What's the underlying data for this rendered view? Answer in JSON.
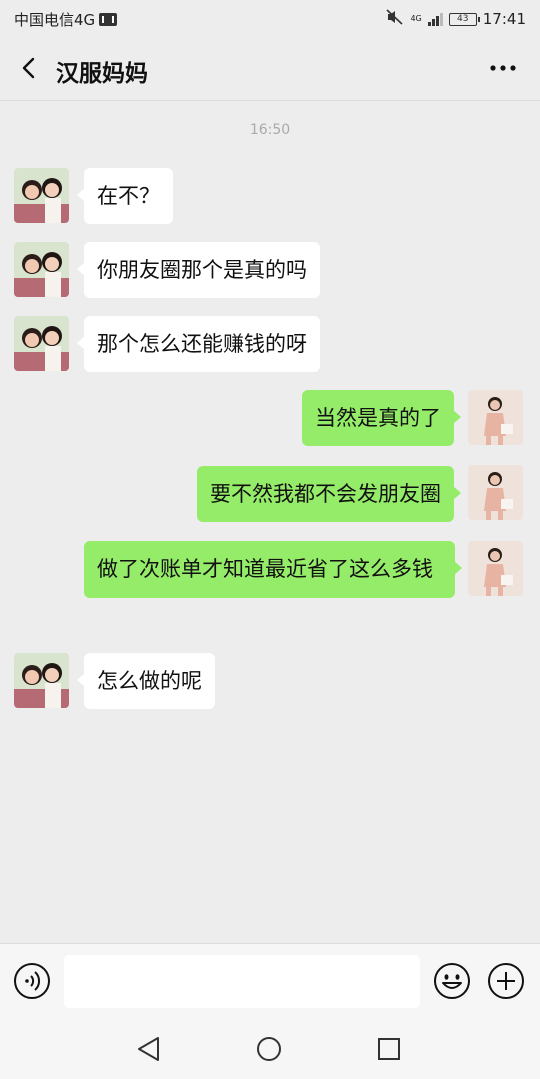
{
  "status_bar": {
    "carrier": "中国电信4G",
    "network_badge": "4G",
    "battery": "43",
    "time": "17:41"
  },
  "chat": {
    "title": "汉服妈妈"
  },
  "timestamp": "16:50",
  "messages": [
    {
      "side": "in",
      "text": "在不？"
    },
    {
      "side": "in",
      "text": "你朋友圈那个是真的吗"
    },
    {
      "side": "in",
      "text": "那个怎么还能赚钱的呀"
    },
    {
      "side": "out",
      "text": "当然是真的了"
    },
    {
      "side": "out",
      "text": "要不然我都不会发朋友圈"
    },
    {
      "side": "out",
      "text": "做了次账单才知道最近省了这么多钱"
    },
    {
      "side": "in",
      "text": "怎么做的呢"
    }
  ],
  "input": {
    "value": "",
    "placeholder": ""
  },
  "colors": {
    "background": "#ededed",
    "incoming_bubble": "#ffffff",
    "outgoing_bubble": "#95ec69",
    "timestamp": "#aaaaaa"
  },
  "icons": {
    "back": "chevron-left-icon",
    "more": "more-dots-icon",
    "voice": "voice-icon",
    "emoji": "smiley-icon",
    "plus": "plus-circle-icon"
  }
}
